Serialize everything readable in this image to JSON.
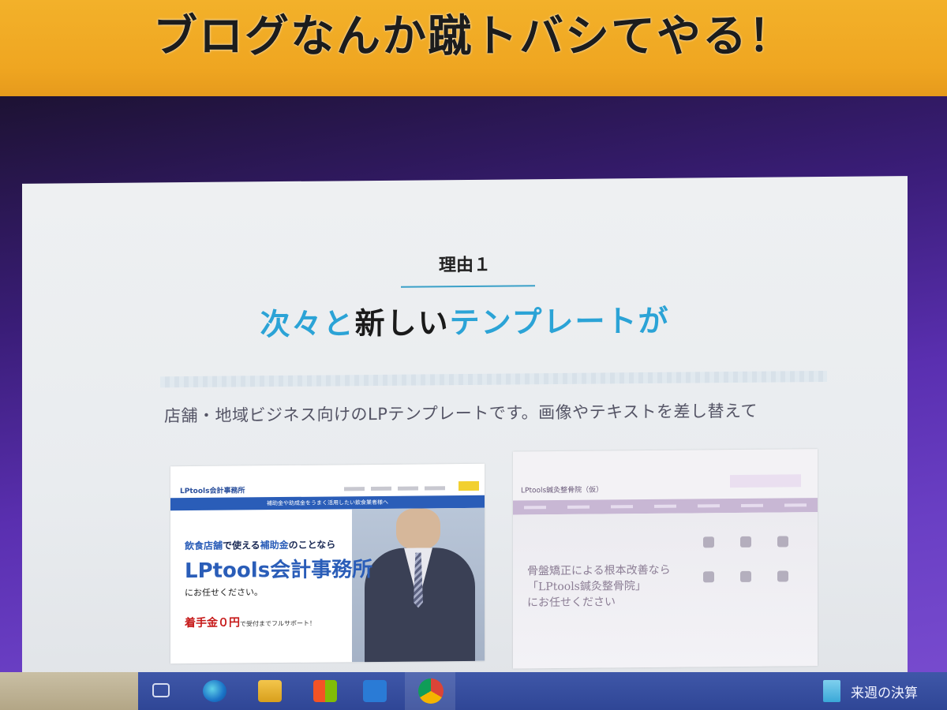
{
  "banner": {
    "title": "ブログなんか蹴トバシてやる！"
  },
  "page": {
    "reason_label": "理由１",
    "headline": {
      "part1": "次々と",
      "part2": "新しい",
      "part3": "テンプレートが"
    },
    "description": "店舗・地域ビジネス向けのLPテンプレートです。画像やテキストを差し替えて"
  },
  "thumbnails": {
    "a": {
      "logo_small": "LPtools会計事務所",
      "bluebar": "補助金や助成金をうまく活用したい飲食業者様へ",
      "copy1_a": "飲食店舗",
      "copy1_b": "で使える",
      "copy1_c": "補助金",
      "copy1_d": "のことなら",
      "logo_big": "LPtools会計事務所",
      "copy2": "にお任せください。",
      "copy4_a": "着手金０円",
      "copy4_b": "で受付までフルサポート！"
    },
    "b": {
      "title": "LPtools鍼灸整骨院（仮）",
      "hero_line1": "骨盤矯正による根本改善なら",
      "hero_line2": "「LPtools鍼灸整骨院」",
      "hero_line3": "にお任せください"
    }
  },
  "taskbar": {
    "doc_label": "来週の決算"
  },
  "colors": {
    "banner": "#f3b12a",
    "accent_blue": "#2ba3d6",
    "taskbar": "#3f57a8"
  }
}
